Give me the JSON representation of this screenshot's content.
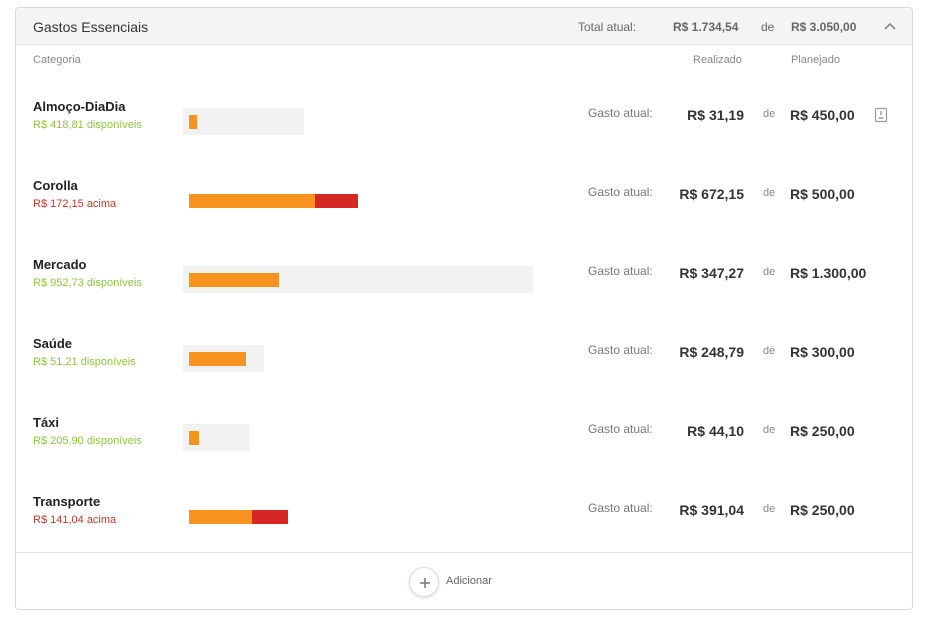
{
  "header": {
    "title": "Gastos Essenciais",
    "total_label": "Total atual:",
    "total_value": "R$ 1.734,54",
    "de_label": "de",
    "planned_value": "R$ 3.050,00",
    "collapse_icon": "chevron-up-icon"
  },
  "columns": {
    "category": "Categoria",
    "realized": "Realizado",
    "planned": "Planejado"
  },
  "rows": [
    {
      "name": "Almoço-DiaDia",
      "status": "R$ 418,81 disponíveis",
      "status_type": "ok",
      "gasto_label": "Gasto atual:",
      "realized": "R$ 31,19",
      "de": "de",
      "planned": "R$ 450,00",
      "spent_fraction": 0.069,
      "has_note": true
    },
    {
      "name": "Corolla",
      "status": "R$ 172,15 acima",
      "status_type": "over",
      "gasto_label": "Gasto atual:",
      "realized": "R$ 672,15",
      "de": "de",
      "planned": "R$ 500,00",
      "spent_fraction": 1.344,
      "has_note": false
    },
    {
      "name": "Mercado",
      "status": "R$ 952,73 disponíveis",
      "status_type": "ok",
      "gasto_label": "Gasto atual:",
      "realized": "R$ 347,27",
      "de": "de",
      "planned": "R$ 1.300,00",
      "spent_fraction": 0.267,
      "has_note": false
    },
    {
      "name": "Saúde",
      "status": "R$ 51,21 disponíveis",
      "status_type": "ok",
      "gasto_label": "Gasto atual:",
      "realized": "R$ 248,79",
      "de": "de",
      "planned": "R$ 300,00",
      "spent_fraction": 0.829,
      "has_note": false
    },
    {
      "name": "Táxi",
      "status": "R$ 205,90 disponíveis",
      "status_type": "ok",
      "gasto_label": "Gasto atual:",
      "realized": "R$ 44,10",
      "de": "de",
      "planned": "R$ 250,00",
      "spent_fraction": 0.176,
      "has_note": false
    },
    {
      "name": "Transporte",
      "status": "R$ 141,04 acima",
      "status_type": "over",
      "gasto_label": "Gasto atual:",
      "realized": "R$ 391,04",
      "de": "de",
      "planned": "R$ 250,00",
      "spent_fraction": 1.564,
      "has_note": false
    }
  ],
  "footer": {
    "add_label": "Adicionar",
    "add_icon": "plus-icon"
  },
  "colors": {
    "spent": "#f7931e",
    "over": "#d62727",
    "available": "#8cc63f",
    "over_text": "#c0392b"
  }
}
